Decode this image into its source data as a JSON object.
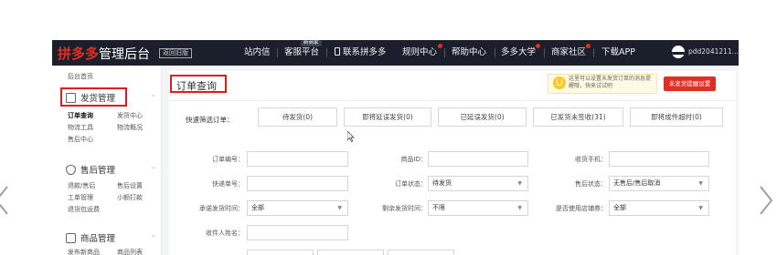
{
  "nav": {
    "brand_red": "拼多多",
    "brand_white": "管理后台",
    "back_old": "返回旧版",
    "items": [
      {
        "label": "站内信"
      },
      {
        "label": "客服平台"
      },
      {
        "label": "联系拼多多"
      },
      {
        "label": "规则中心"
      },
      {
        "label": "帮助中心"
      },
      {
        "label": "多多大学"
      },
      {
        "label": "商家社区"
      },
      {
        "label": "下载APP"
      }
    ],
    "seller_tag": "新商家",
    "user_name": "pdd2041211...",
    "user_caret": "▾"
  },
  "sidebar": {
    "home": "后台首页",
    "sections": [
      {
        "title": "发货管理",
        "icon": "document-icon",
        "links": [
          "订单查询",
          "发货中心",
          "物流工具",
          "物流概况",
          "售后中心"
        ]
      },
      {
        "title": "售后管理",
        "icon": "shield-icon",
        "links": [
          "退款/售后",
          "售后设置",
          "工单管理",
          "小额打款",
          "退货包运费"
        ]
      },
      {
        "title": "商品管理",
        "icon": "box-icon",
        "links": [
          "发布新商品",
          "商品列表"
        ]
      }
    ],
    "chevron": "⌄"
  },
  "main": {
    "page_title": "订单查询",
    "notice_text": "这里可以设置未发货订单的消息提醒哦，快来试试吧",
    "notice_button": "未发货提醒设置",
    "quick_filter": {
      "label": "快速筛选订单：",
      "buttons": [
        "待发货(0)",
        "即将延误发货(0)",
        "已延误发货(0)",
        "已发货未签收(31)",
        "即将成件超时(0)"
      ]
    },
    "form": {
      "order_no": {
        "label": "订单编号：",
        "value": ""
      },
      "goods_id": {
        "label": "商品ID：",
        "value": ""
      },
      "phone": {
        "label": "收货手机：",
        "value": ""
      },
      "tracking_no": {
        "label": "快递单号：",
        "value": ""
      },
      "order_status": {
        "label": "订单状态：",
        "value": "待发货"
      },
      "aftersale_status": {
        "label": "售后状态：",
        "value": "无售后/售后取消"
      },
      "promise_time": {
        "label": "承诺发货时间：",
        "value": "全部"
      },
      "remaining_time": {
        "label": "剩余发货时间：",
        "value": "不限"
      },
      "coupon": {
        "label": "是否使用店铺券：",
        "value": "全部"
      },
      "receiver": {
        "label": "收件人姓名：",
        "value": ""
      }
    }
  },
  "colors": {
    "brand_red": "#e02e24",
    "nav_bg": "#1b1f2b",
    "highlight_box": "#e11b1b"
  }
}
